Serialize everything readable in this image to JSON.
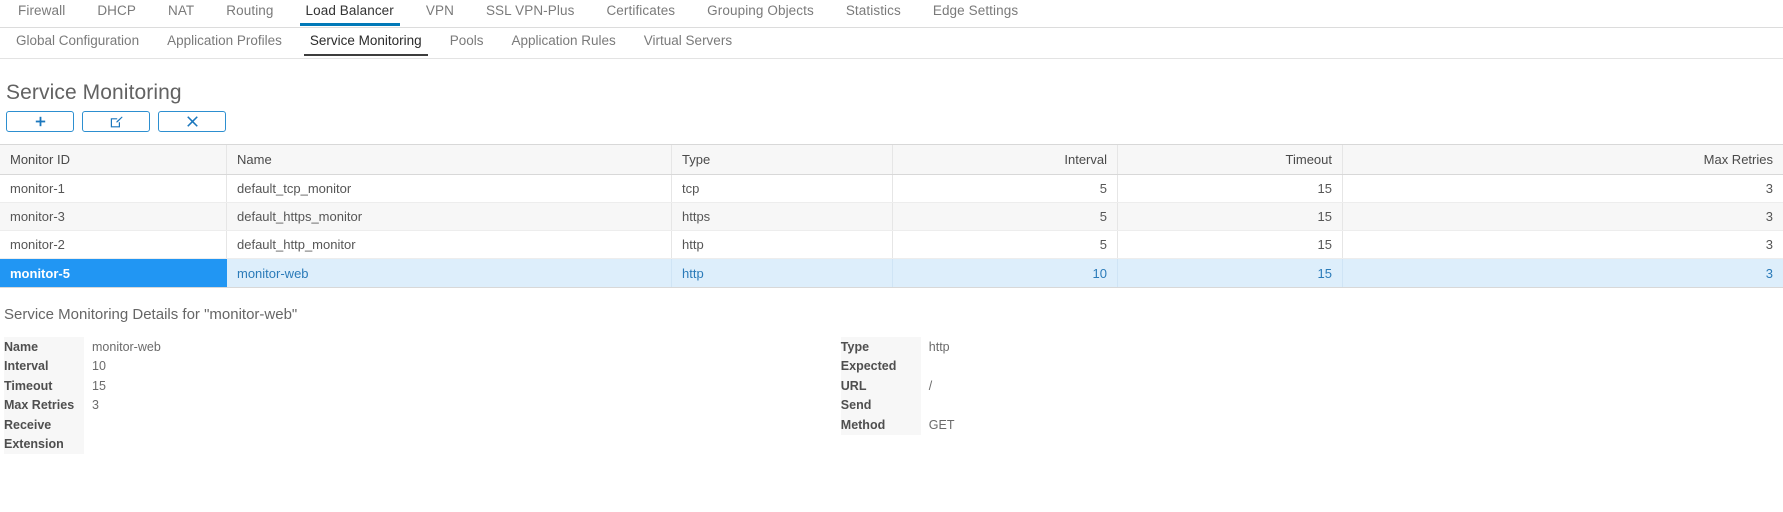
{
  "topnav": {
    "items": [
      {
        "label": "Firewall",
        "active": false
      },
      {
        "label": "DHCP",
        "active": false
      },
      {
        "label": "NAT",
        "active": false
      },
      {
        "label": "Routing",
        "active": false
      },
      {
        "label": "Load Balancer",
        "active": true
      },
      {
        "label": "VPN",
        "active": false
      },
      {
        "label": "SSL VPN-Plus",
        "active": false
      },
      {
        "label": "Certificates",
        "active": false
      },
      {
        "label": "Grouping Objects",
        "active": false
      },
      {
        "label": "Statistics",
        "active": false
      },
      {
        "label": "Edge Settings",
        "active": false
      }
    ],
    "active_accent": "#0079b8"
  },
  "subnav": {
    "items": [
      {
        "label": "Global Configuration",
        "active": false
      },
      {
        "label": "Application Profiles",
        "active": false
      },
      {
        "label": "Service Monitoring",
        "active": true
      },
      {
        "label": "Pools",
        "active": false
      },
      {
        "label": "Application Rules",
        "active": false
      },
      {
        "label": "Virtual Servers",
        "active": false
      }
    ],
    "active_accent": "#3d3d3d"
  },
  "page": {
    "title": "Service Monitoring"
  },
  "toolbar": {
    "add_icon": "plus-icon",
    "edit_icon": "pencil-square-icon",
    "delete_icon": "close-x-icon",
    "accent": "#2d8fd0"
  },
  "table": {
    "columns": [
      {
        "label": "Monitor ID",
        "align": "left"
      },
      {
        "label": "Name",
        "align": "left"
      },
      {
        "label": "Type",
        "align": "left"
      },
      {
        "label": "Interval",
        "align": "right"
      },
      {
        "label": "Timeout",
        "align": "right"
      },
      {
        "label": "Max Retries",
        "align": "right"
      }
    ],
    "rows": [
      {
        "monitor_id": "monitor-1",
        "name": "default_tcp_monitor",
        "type": "tcp",
        "interval": "5",
        "timeout": "15",
        "max_retries": "3",
        "selected": false
      },
      {
        "monitor_id": "monitor-3",
        "name": "default_https_monitor",
        "type": "https",
        "interval": "5",
        "timeout": "15",
        "max_retries": "3",
        "selected": false
      },
      {
        "monitor_id": "monitor-2",
        "name": "default_http_monitor",
        "type": "http",
        "interval": "5",
        "timeout": "15",
        "max_retries": "3",
        "selected": false
      },
      {
        "monitor_id": "monitor-5",
        "name": "monitor-web",
        "type": "http",
        "interval": "10",
        "timeout": "15",
        "max_retries": "3",
        "selected": true
      }
    ],
    "selected_bg": "#2196f3",
    "selected_row_bg": "#ddeefb"
  },
  "details": {
    "title": "Service Monitoring Details for \"monitor-web\"",
    "left": [
      {
        "label": "Name",
        "value": "monitor-web"
      },
      {
        "label": "Interval",
        "value": "10"
      },
      {
        "label": "Timeout",
        "value": "15"
      },
      {
        "label": "Max Retries",
        "value": "3"
      },
      {
        "label": "Receive",
        "value": ""
      },
      {
        "label": "Extension",
        "value": ""
      }
    ],
    "right": [
      {
        "label": "Type",
        "value": "http"
      },
      {
        "label": "Expected",
        "value": ""
      },
      {
        "label": "URL",
        "value": "/"
      },
      {
        "label": "Send",
        "value": ""
      },
      {
        "label": "Method",
        "value": "GET"
      }
    ]
  }
}
